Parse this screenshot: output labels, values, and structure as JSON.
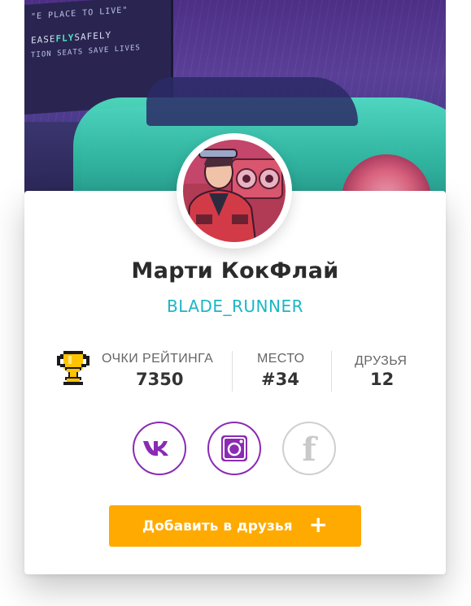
{
  "cover": {
    "sign_line1": "\"E PLACE TO LIVE\"",
    "sign_line2_a": "EASE",
    "sign_line2_fly": "FLY",
    "sign_line2_b": "SAFELY",
    "sign_line3": "TION SEATS SAVE LIVES"
  },
  "profile": {
    "name": "Марти КокФлай",
    "username": "BLADE_RUNNER"
  },
  "stats": {
    "rating_label": "ОЧКИ РЕЙТИНГА",
    "rating_value": "7350",
    "place_label": "МЕСТО",
    "place_value": "#34",
    "friends_label": "ДРУЗЬЯ",
    "friends_value": "12"
  },
  "social": {
    "vk_label": "vk",
    "ig_label": "instagram",
    "fb_label": "f"
  },
  "actions": {
    "add_friend_label": "Добавить в друзья",
    "add_friend_icon": "+"
  },
  "colors": {
    "accent_orange": "#ffaa00",
    "accent_teal": "#1bb6c6",
    "accent_purple": "#8a2bb4",
    "muted_gray": "#cfcfcf"
  }
}
